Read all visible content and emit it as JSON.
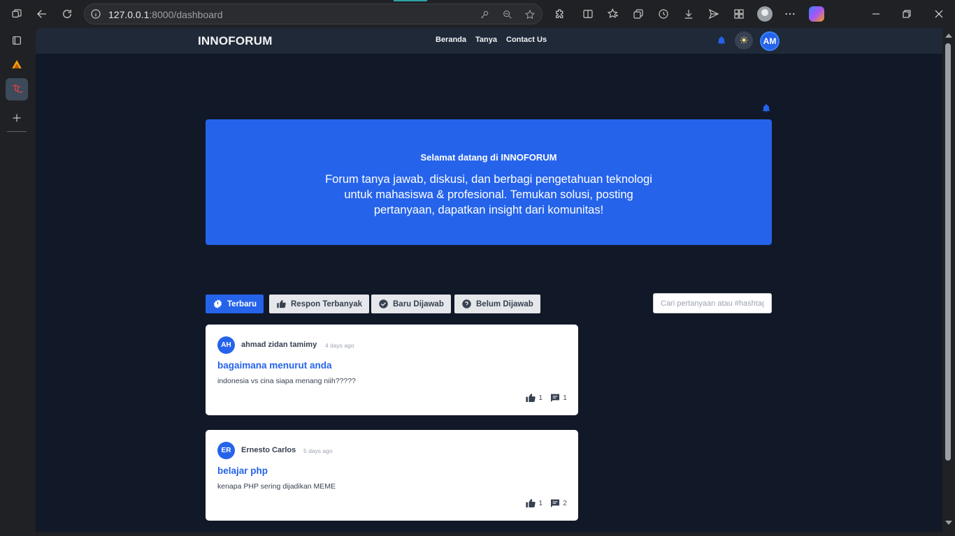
{
  "browser": {
    "url_host": "127.0.0.1",
    "url_path": ":8000/dashboard"
  },
  "site": {
    "brand": "INNOFORUM",
    "nav_links": [
      "Beranda",
      "Tanya",
      "Contact Us"
    ],
    "user_initials": "AM"
  },
  "hero": {
    "title": "Selamat datang di INNOFORUM",
    "description": "Forum tanya jawab, diskusi, dan berbagi pengetahuan teknologi untuk mahasiswa & profesional. Temukan solusi, posting pertanyaan, dapatkan insight dari komunitas!"
  },
  "filters": [
    {
      "label": "Terbaru",
      "active": true,
      "icon": "badge-icon"
    },
    {
      "label": "Respon Terbanyak",
      "active": false,
      "icon": "thumbs-up-icon"
    },
    {
      "label": "Baru Dijawab",
      "active": false,
      "icon": "check-circle-icon"
    },
    {
      "label": "Belum Dijawab",
      "active": false,
      "icon": "question-circle-icon"
    }
  ],
  "search": {
    "placeholder": "Cari pertanyaan atau #hashtag"
  },
  "questions": [
    {
      "initials": "AH",
      "author": "ahmad zidan tamimy",
      "time": "4 days ago",
      "title": "bagaimana menurut anda",
      "body": "indonesia vs cina siapa menang niih?????",
      "likes": "1",
      "comments": "1"
    },
    {
      "initials": "ER",
      "author": "Ernesto Carlos",
      "time": "5 days ago",
      "title": "belajar php",
      "body": "kenapa PHP sering dijadikan MEME",
      "likes": "1",
      "comments": "2"
    }
  ],
  "colors": {
    "primary": "#2563eb",
    "page_bg": "#111827",
    "navbar_bg": "#1f2937"
  }
}
